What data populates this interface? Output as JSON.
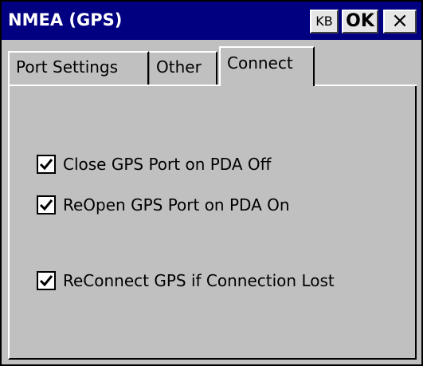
{
  "window": {
    "title": "NMEA (GPS)"
  },
  "titlebar_buttons": {
    "kb_label": "KB",
    "ok_label": "OK",
    "close_label": "×"
  },
  "tabs": [
    {
      "label": "Port Settings",
      "selected": false
    },
    {
      "label": "Other",
      "selected": false
    },
    {
      "label": "Connect",
      "selected": true
    }
  ],
  "options": [
    {
      "label": "Close GPS Port on PDA Off",
      "checked": true
    },
    {
      "label": "ReOpen GPS Port on PDA On",
      "checked": true
    },
    {
      "label": "ReConnect GPS if Connection Lost",
      "checked": true
    }
  ],
  "colors": {
    "titlebar_bg": "#000080",
    "window_bg": "#c0c0c0",
    "title_text": "#ffffff"
  }
}
